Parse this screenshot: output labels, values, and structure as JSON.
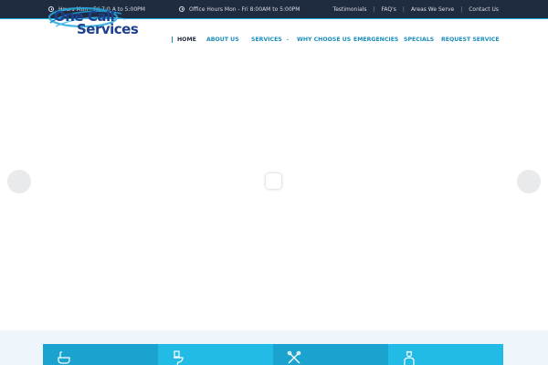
{
  "topbar": {
    "hours_1": "Hours Mon - Fri 7:0  A   to 5:00PM",
    "hours_2": "Office Hours Mon - Fri 8:00AM to 5:00PM",
    "links": [
      "Testimonials",
      "FAQ's",
      "Areas We Serve",
      "Contact Us"
    ],
    "separator": "|"
  },
  "logo": {
    "line1": "One Call",
    "line2": "Services"
  },
  "nav": {
    "items": [
      "HOME",
      "ABOUT US",
      "SERVICES",
      "WHY CHOOSE US",
      "EMERGENCIES",
      "SPECIALS",
      "REQUEST SERVICE"
    ],
    "dropdown_glyph": "⌄"
  },
  "services": {
    "tiles": [
      {
        "icon": "bathtub-icon",
        "color": "#1aa3cf"
      },
      {
        "icon": "toilet-icon",
        "color": "#22bbe6"
      },
      {
        "icon": "wrench-tools-icon",
        "color": "#1aa3cf"
      },
      {
        "icon": "plumber-icon",
        "color": "#22bbe6"
      }
    ]
  },
  "colors": {
    "topbar": "#1f2b3f",
    "accent": "#1a8dbb",
    "brand": "#1d3f8c",
    "band": "#eef5fb"
  }
}
